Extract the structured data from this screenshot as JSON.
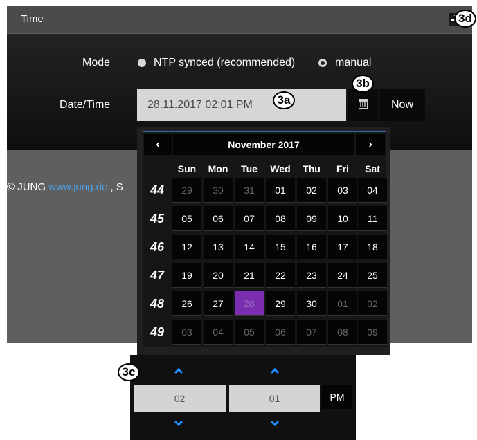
{
  "header": {
    "title": "Time"
  },
  "form": {
    "mode_label": "Mode",
    "mode_options": [
      {
        "label": "NTP synced (recommended)",
        "selected": false
      },
      {
        "label": "manual",
        "selected": true
      }
    ],
    "datetime_label": "Date/Time",
    "datetime_value": "28.11.2017 02:01 PM",
    "now_label": "Now"
  },
  "footer": {
    "prefix": "© JUNG ",
    "link": "www.jung.de",
    "suffix": " , S"
  },
  "calendar": {
    "prev": "‹",
    "next": "›",
    "month_label": "November 2017",
    "weekdays": [
      "Sun",
      "Mon",
      "Tue",
      "Wed",
      "Thu",
      "Fri",
      "Sat"
    ],
    "weeks": [
      {
        "num": "44",
        "days": [
          "29",
          "30",
          "31",
          "01",
          "02",
          "03",
          "04"
        ],
        "muted": [
          0,
          1,
          2
        ]
      },
      {
        "num": "45",
        "days": [
          "05",
          "06",
          "07",
          "08",
          "09",
          "10",
          "11"
        ],
        "muted": []
      },
      {
        "num": "46",
        "days": [
          "12",
          "13",
          "14",
          "15",
          "16",
          "17",
          "18"
        ],
        "muted": []
      },
      {
        "num": "47",
        "days": [
          "19",
          "20",
          "21",
          "22",
          "23",
          "24",
          "25"
        ],
        "muted": []
      },
      {
        "num": "48",
        "days": [
          "26",
          "27",
          "28",
          "29",
          "30",
          "01",
          "02"
        ],
        "muted": [
          5,
          6
        ]
      },
      {
        "num": "49",
        "days": [
          "03",
          "04",
          "05",
          "06",
          "07",
          "08",
          "09"
        ],
        "muted": [
          0,
          1,
          2,
          3,
          4,
          5,
          6
        ]
      }
    ],
    "selected_day": "28",
    "selected_color": "#7b2fb0"
  },
  "timepicker": {
    "hour": "02",
    "separator": ":",
    "minute": "01",
    "ampm": "PM"
  },
  "callouts": {
    "input": "3a",
    "calendar_button": "3b",
    "time_picker": "3c",
    "save": "3d"
  },
  "colors": {
    "link": "#4aa0e6",
    "accent_blue": "#1e90ff",
    "calendar_border": "#3a6ea8"
  }
}
